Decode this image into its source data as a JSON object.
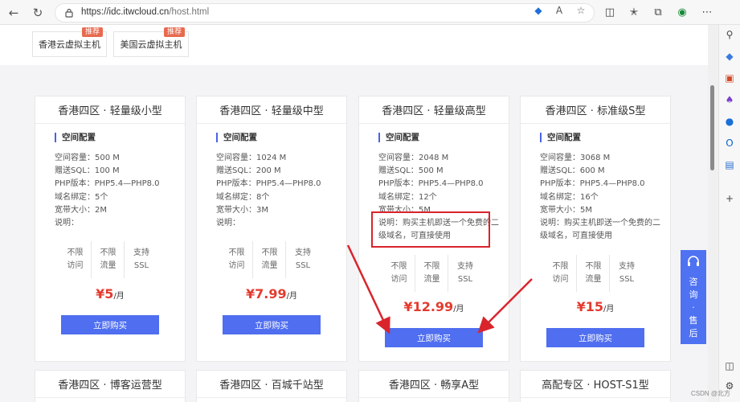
{
  "browser": {
    "url_host": "https://idc.itwcloud.cn",
    "url_path": "/host.html"
  },
  "region_tabs": [
    {
      "label": "香港云虚拟主机",
      "badge": "推荐"
    },
    {
      "label": "美国云虚拟主机",
      "badge": "推荐"
    }
  ],
  "section_label": "空间配置",
  "features": [
    "不限\n访问",
    "不限\n流量",
    "支持\nSSL"
  ],
  "buy_label": "立即购买",
  "price_unit": "/月",
  "cards": [
    {
      "title": "香港四区 · 轻量级小型",
      "specs": [
        "空间容量：500 M",
        "赠送SQL：100 M",
        "PHP版本：PHP5.4—PHP8.0",
        "域名绑定：5个",
        "宽带大小：2M"
      ],
      "note": "说明：",
      "price": "¥5"
    },
    {
      "title": "香港四区 · 轻量级中型",
      "specs": [
        "空间容量：1024 M",
        "赠送SQL：200 M",
        "PHP版本：PHP5.4—PHP8.0",
        "域名绑定：8个",
        "宽带大小：3M"
      ],
      "note": "说明：",
      "price": "¥7.99"
    },
    {
      "title": "香港四区 · 轻量级高型",
      "specs": [
        "空间容量：2048 M",
        "赠送SQL：500 M",
        "PHP版本：PHP5.4—PHP8.0",
        "域名绑定：12个",
        "宽带大小：5M"
      ],
      "note": "说明：购买主机即送一个免费的二级域名，可直接使用",
      "price": "¥12.99"
    },
    {
      "title": "香港四区 · 标准级S型",
      "specs": [
        "空间容量：3068 M",
        "赠送SQL：600 M",
        "PHP版本：PHP5.4—PHP8.0",
        "域名绑定：16个",
        "宽带大小：5M"
      ],
      "note": "说明：购买主机即送一个免费的二级域名，可直接使用",
      "price": "¥15"
    }
  ],
  "bottom_cards": [
    "香港四区 · 博客运营型",
    "香港四区 · 百城千站型",
    "香港四区 · 畅享A型",
    "高配专区 · HOST-S1型"
  ],
  "consult": {
    "chars": [
      "咨",
      "询",
      "·",
      "售",
      "后"
    ]
  },
  "watermark": "CSDN @北方"
}
